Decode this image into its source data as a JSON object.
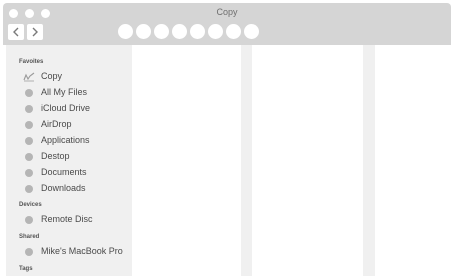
{
  "window": {
    "title": "Copy"
  },
  "toolbar": {
    "circle_count": 8
  },
  "sidebar": {
    "sections": [
      {
        "header": "Favoites",
        "items": [
          {
            "label": "Copy",
            "icon": "pencil-icon"
          },
          {
            "label": "All My Files",
            "icon": "circle-icon"
          },
          {
            "label": "iCloud Drive",
            "icon": "circle-icon"
          },
          {
            "label": "AirDrop",
            "icon": "circle-icon"
          },
          {
            "label": "Applications",
            "icon": "circle-icon"
          },
          {
            "label": "Destop",
            "icon": "circle-icon"
          },
          {
            "label": "Documents",
            "icon": "circle-icon"
          },
          {
            "label": "Downloads",
            "icon": "circle-icon"
          }
        ]
      },
      {
        "header": "Devices",
        "items": [
          {
            "label": "Remote Disc",
            "icon": "circle-icon"
          }
        ]
      },
      {
        "header": "Shared",
        "items": [
          {
            "label": "Mike's MacBook Pro",
            "icon": "circle-icon"
          }
        ]
      },
      {
        "header": "Tags",
        "items": []
      }
    ]
  },
  "colors": {
    "titlebar": "#d5d5d5",
    "sidebar": "#f0f0f0",
    "dot": "#b5b5b5"
  }
}
